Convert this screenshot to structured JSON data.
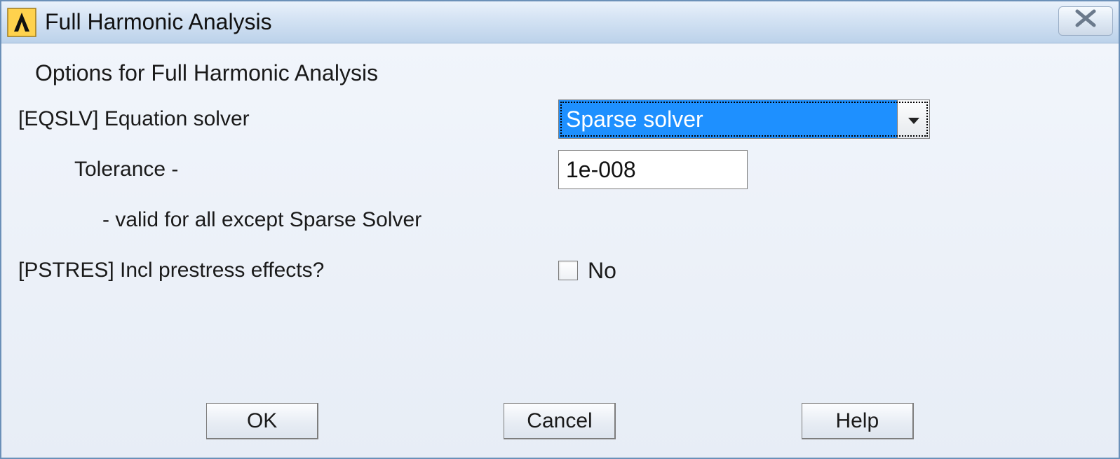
{
  "window": {
    "title": "Full Harmonic Analysis"
  },
  "form": {
    "subtitle": "Options for Full Harmonic Analysis",
    "eqslv_label": "[EQSLV]  Equation solver",
    "eqslv_value": "Sparse solver",
    "tolerance_label": "Tolerance -",
    "tolerance_value": "1e-008",
    "tolerance_note": "- valid for all except Sparse Solver",
    "pstres_label": "[PSTRES] Incl prestress effects?",
    "pstres_checked": false,
    "pstres_text": "No"
  },
  "buttons": {
    "ok": "OK",
    "cancel": "Cancel",
    "help": "Help"
  }
}
